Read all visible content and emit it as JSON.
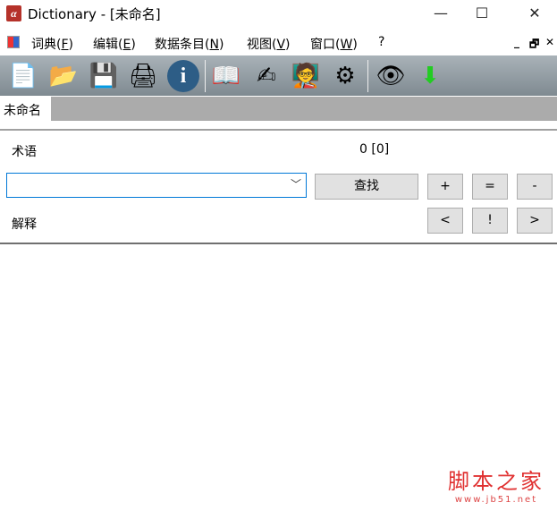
{
  "window": {
    "title": "Dictionary - [未命名]",
    "app_icon": "α",
    "minimize": "—",
    "maximize": "☐",
    "close": "✕"
  },
  "menu": {
    "items": [
      {
        "label": "词典(",
        "key": "F",
        "end": ")"
      },
      {
        "label": "编辑(",
        "key": "E",
        "end": ")"
      },
      {
        "label": "数据条目(",
        "key": "N",
        "end": ")"
      },
      {
        "label": "视图(",
        "key": "V",
        "end": ")"
      },
      {
        "label": "窗口(",
        "key": "W",
        "end": ")"
      },
      {
        "label": "?",
        "key": "",
        "end": ""
      }
    ],
    "mdi_min": "_",
    "mdi_restore": "🗗",
    "mdi_close": "✕"
  },
  "toolbar": {
    "icons": [
      "new-document-icon",
      "open-folder-icon",
      "save-icon",
      "print-icon",
      "info-icon",
      "open-book-icon",
      "edit-book-icon",
      "presenter-icon",
      "settings-gear-icon",
      "clipboard-view-icon",
      "clipboard-import-icon"
    ]
  },
  "tabs": [
    {
      "label": "未命名"
    }
  ],
  "form": {
    "term_label": "术语",
    "count": "0 [0]",
    "term_value": "",
    "search_button": "查找",
    "add_button": "+",
    "equal_button": "=",
    "remove_button": "-",
    "explanation_label": "解释",
    "prev_button": "<",
    "bang_button": "!",
    "next_button": ">"
  },
  "explanation_text": "",
  "watermark": {
    "line1": "脚本之家",
    "line2": "www.jb51.net"
  }
}
